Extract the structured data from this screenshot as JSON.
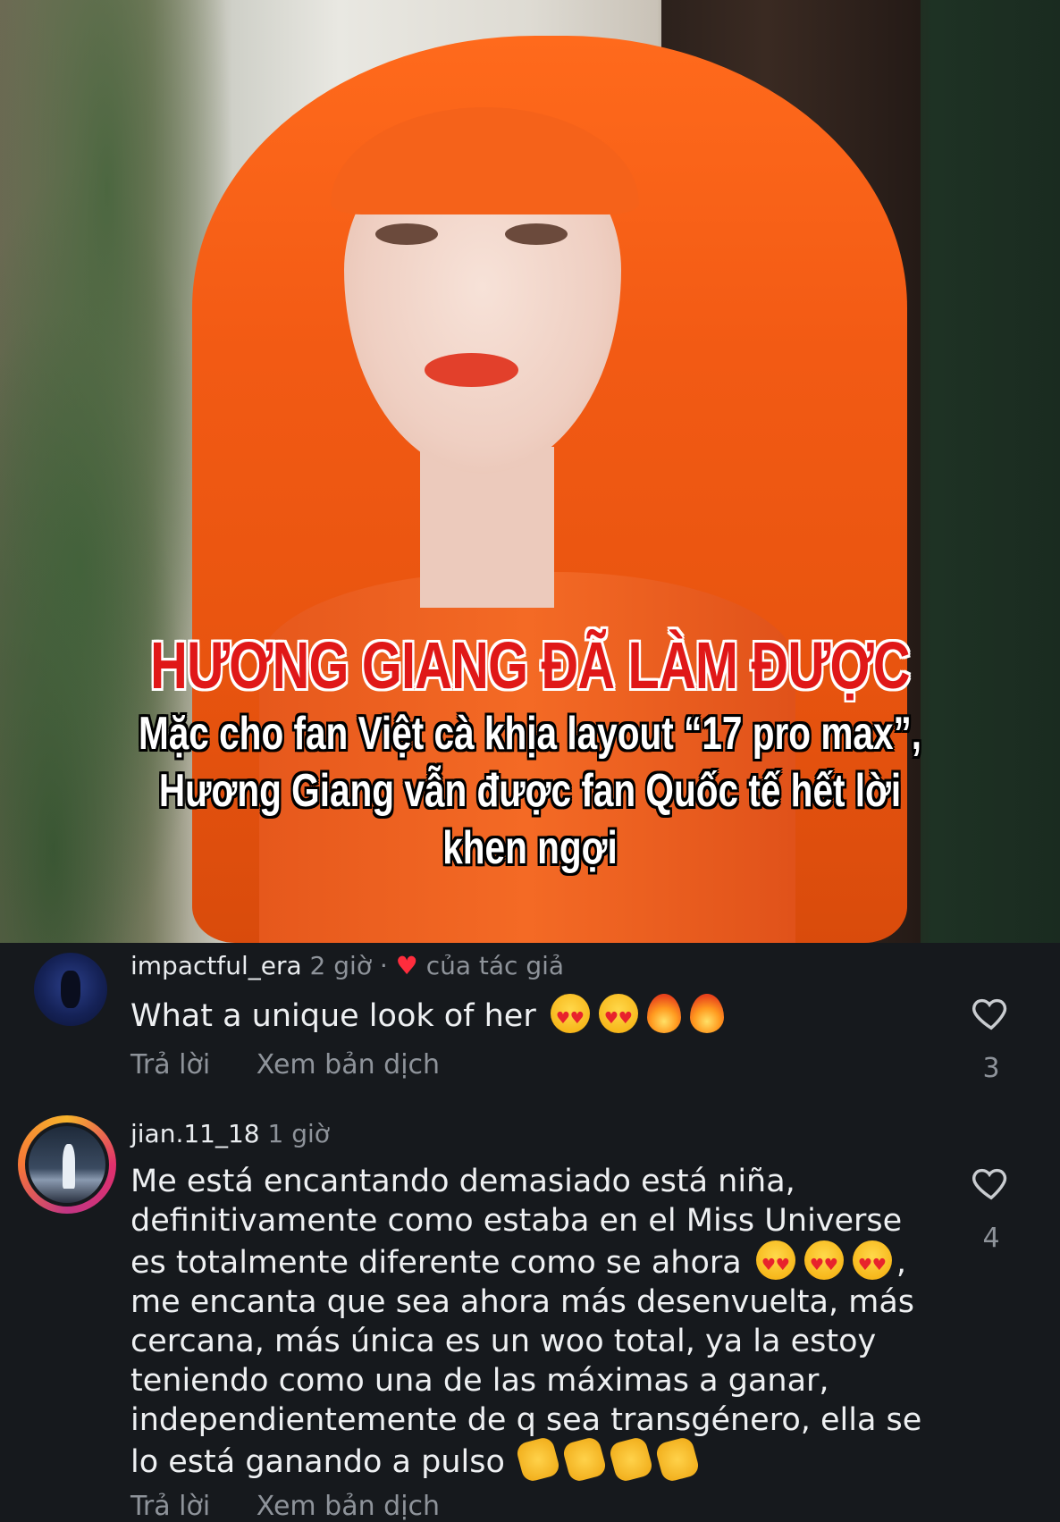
{
  "video": {
    "headline": "HƯƠNG GIANG ĐÃ LÀM ĐƯỢC",
    "subtitle_lines": [
      "Mặc cho fan Việt cà khịa layout “17 pro max”,",
      "Hương Giang vẫn được fan Quốc tế hết lời",
      "khen ngợi"
    ]
  },
  "comments": [
    {
      "username": "impactful_era",
      "time": "2 giờ",
      "separator": "·",
      "author_like_label": "của tác giả",
      "text": "What a unique look of her",
      "emojis": [
        "heart-eyes",
        "heart-eyes",
        "fire",
        "fire"
      ],
      "reply_label": "Trả lời",
      "translate_label": "Xem bản dịch",
      "like_count": "3"
    },
    {
      "username": "jian.11_18",
      "time": "1 giờ",
      "text_lines": [
        "Me está encantando demasiado está niña,",
        "definitivamente como estaba en el Miss Universe",
        "es totalmente diferente como se ahora",
        "me encanta que sea ahora más desenvuelta, más",
        "cercana, más única es un woo total, ya la estoy",
        "teniendo como una de las máximas a ganar,",
        "independientemente de q sea transgénero, ella se",
        "lo está ganando a pulso"
      ],
      "line3_suffix": ",",
      "emojis_line3": [
        "heart-eyes",
        "heart-eyes",
        "heart-eyes"
      ],
      "emojis_line8": [
        "clap",
        "clap",
        "clap",
        "clap"
      ],
      "reply_label": "Trả lời",
      "translate_label": "Xem bản dịch",
      "like_count": "4"
    }
  ],
  "colors": {
    "background": "#16191d",
    "headline": "#e01818",
    "meta_text": "#8e939a",
    "author_heart": "#ff2d3d"
  }
}
